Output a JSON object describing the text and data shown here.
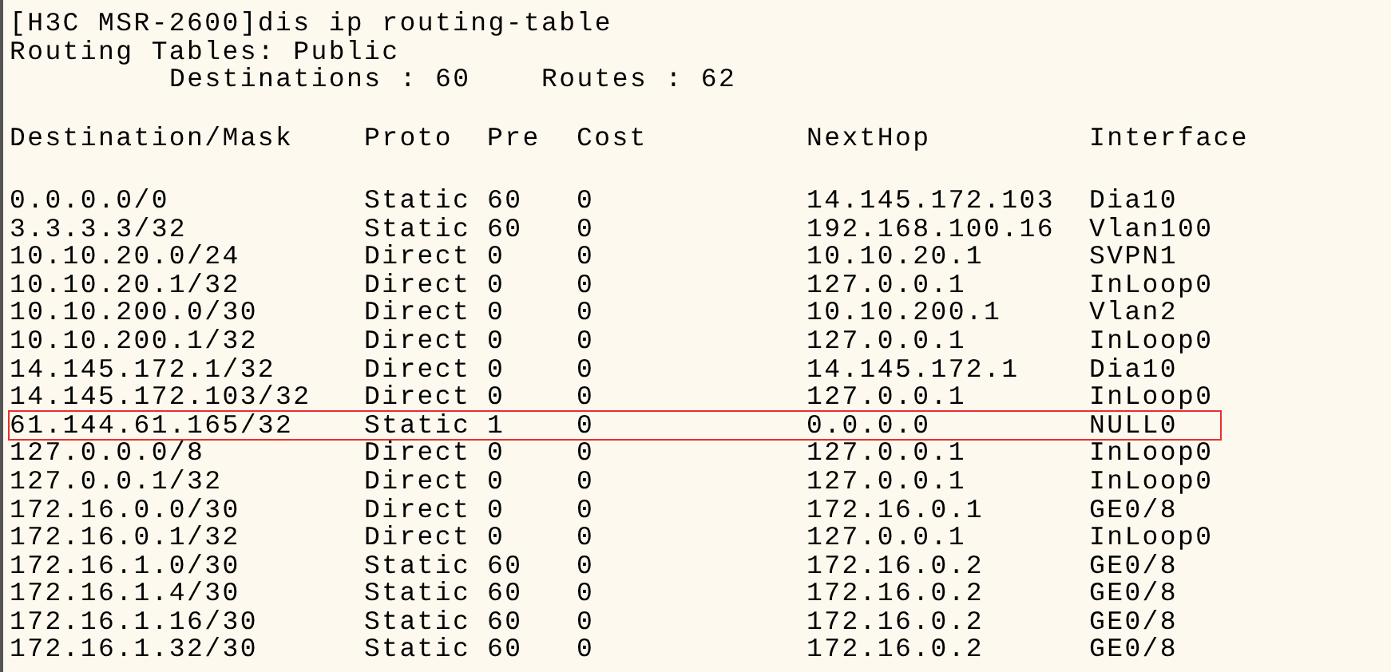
{
  "command": "[H3C MSR-2600]dis ip routing-table",
  "table_title": "Routing Tables: Public",
  "summary": {
    "destinations": "Destinations : 60",
    "routes": "Routes : 62"
  },
  "columns": [
    "Destination/Mask",
    "Proto",
    "Pre",
    "Cost",
    "NextHop",
    "Interface"
  ],
  "rows": [
    {
      "cells": [
        "0.0.0.0/0",
        "Static",
        "60",
        "0",
        "14.145.172.103",
        "Dia10"
      ],
      "highlighted": false
    },
    {
      "cells": [
        "3.3.3.3/32",
        "Static",
        "60",
        "0",
        "192.168.100.16",
        "Vlan100"
      ],
      "highlighted": false
    },
    {
      "cells": [
        "10.10.20.0/24",
        "Direct",
        "0",
        "0",
        "10.10.20.1",
        "SVPN1"
      ],
      "highlighted": false
    },
    {
      "cells": [
        "10.10.20.1/32",
        "Direct",
        "0",
        "0",
        "127.0.0.1",
        "InLoop0"
      ],
      "highlighted": false
    },
    {
      "cells": [
        "10.10.200.0/30",
        "Direct",
        "0",
        "0",
        "10.10.200.1",
        "Vlan2"
      ],
      "highlighted": false
    },
    {
      "cells": [
        "10.10.200.1/32",
        "Direct",
        "0",
        "0",
        "127.0.0.1",
        "InLoop0"
      ],
      "highlighted": false
    },
    {
      "cells": [
        "14.145.172.1/32",
        "Direct",
        "0",
        "0",
        "14.145.172.1",
        "Dia10"
      ],
      "highlighted": false
    },
    {
      "cells": [
        "14.145.172.103/32",
        "Direct",
        "0",
        "0",
        "127.0.0.1",
        "InLoop0"
      ],
      "highlighted": false
    },
    {
      "cells": [
        "61.144.61.165/32",
        "Static",
        "1",
        "0",
        "0.0.0.0",
        "NULL0"
      ],
      "highlighted": true
    },
    {
      "cells": [
        "127.0.0.0/8",
        "Direct",
        "0",
        "0",
        "127.0.0.1",
        "InLoop0"
      ],
      "highlighted": false
    },
    {
      "cells": [
        "127.0.0.1/32",
        "Direct",
        "0",
        "0",
        "127.0.0.1",
        "InLoop0"
      ],
      "highlighted": false
    },
    {
      "cells": [
        "172.16.0.0/30",
        "Direct",
        "0",
        "0",
        "172.16.0.1",
        "GE0/8"
      ],
      "highlighted": false
    },
    {
      "cells": [
        "172.16.0.1/32",
        "Direct",
        "0",
        "0",
        "127.0.0.1",
        "InLoop0"
      ],
      "highlighted": false
    },
    {
      "cells": [
        "172.16.1.0/30",
        "Static",
        "60",
        "0",
        "172.16.0.2",
        "GE0/8"
      ],
      "highlighted": false
    },
    {
      "cells": [
        "172.16.1.4/30",
        "Static",
        "60",
        "0",
        "172.16.0.2",
        "GE0/8"
      ],
      "highlighted": false
    },
    {
      "cells": [
        "172.16.1.16/30",
        "Static",
        "60",
        "0",
        "172.16.0.2",
        "GE0/8"
      ],
      "highlighted": false
    },
    {
      "cells": [
        "172.16.1.32/30",
        "Static",
        "60",
        "0",
        "172.16.0.2",
        "GE0/8"
      ],
      "highlighted": false
    }
  ]
}
